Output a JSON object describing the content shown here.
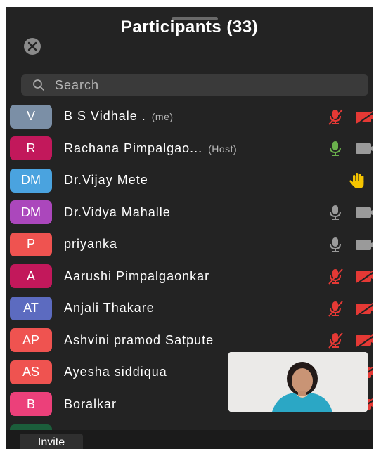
{
  "header": {
    "title": "Participants (33)"
  },
  "search": {
    "placeholder": "Search"
  },
  "participants": [
    {
      "initials": "V",
      "name": "B S Vidhale .",
      "tag": "(me)",
      "avatar_color": "#7b8fa6",
      "mic": "muted",
      "cam": "off"
    },
    {
      "initials": "R",
      "name": "Rachana Pimpalgao...",
      "tag": "(Host)",
      "avatar_color": "#c2185b",
      "mic": "on",
      "cam": "on"
    },
    {
      "initials": "DM",
      "name": "Dr.Vijay Mete",
      "tag": "",
      "avatar_color": "#4aa3df",
      "mic": "",
      "cam": "",
      "hand": "raised"
    },
    {
      "initials": "DM",
      "name": "Dr.Vidya Mahalle",
      "tag": "",
      "avatar_color": "#ab47bc",
      "mic": "idle",
      "cam": "on"
    },
    {
      "initials": "P",
      "name": "priyanka",
      "tag": "",
      "avatar_color": "#ef5350",
      "mic": "idle",
      "cam": "on"
    },
    {
      "initials": "A",
      "name": "Aarushi Pimpalgaonkar",
      "tag": "",
      "avatar_color": "#c2185b",
      "mic": "muted",
      "cam": "off"
    },
    {
      "initials": "AT",
      "name": "Anjali Thakare",
      "tag": "",
      "avatar_color": "#5c6bc0",
      "mic": "muted",
      "cam": "off"
    },
    {
      "initials": "AP",
      "name": "Ashvini pramod Satpute",
      "tag": "",
      "avatar_color": "#ef5350",
      "mic": "muted",
      "cam": "off"
    },
    {
      "initials": "AS",
      "name": "Ayesha siddiqua",
      "tag": "",
      "avatar_color": "#ef5350",
      "mic": "muted",
      "cam": "off"
    },
    {
      "initials": "B",
      "name": "Boralkar",
      "tag": "",
      "avatar_color": "#ec407a",
      "mic": "muted",
      "cam": "off"
    }
  ],
  "footer": {
    "invite_label": "Invite"
  },
  "colors": {
    "background": "#232323",
    "muted_red": "#e53935",
    "active_green": "#6ab04c",
    "hand_yellow": "#f5c400"
  },
  "icons": {
    "close": "close-icon",
    "search": "search-icon",
    "mic": "microphone-icon",
    "cam": "video-camera-icon",
    "hand": "raised-hand-icon"
  }
}
